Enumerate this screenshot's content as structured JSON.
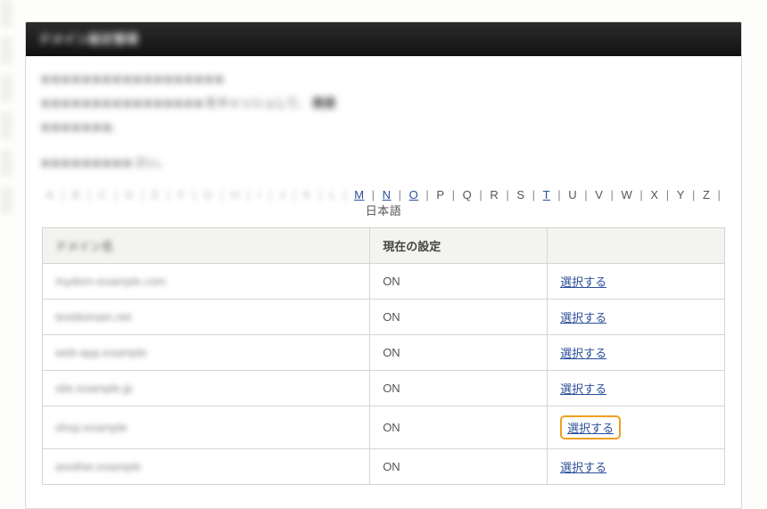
{
  "header": {
    "title_blur": "ドメイン設定管理"
  },
  "description": {
    "line1_blur": "■ ■ ■ ■ ■ ■ ■ ■ ■ ■ ■ ■ ■ ■ ■ ■ ■ ■",
    "line2_blur": "■ ■ ■ ■ ■ ■ ■ ■  ■ ■ ■ ■ ■ ■ ■ ■",
    "line2_sharp_a": "をキャッシュして、",
    "line2_sharp_b": "高速",
    "line3_blur": "■ ■ ■ ■ ■ ■ ■。"
  },
  "instruction": {
    "blur_a": "■ ■ ■ ■  ■ ■ ■ ■ ■",
    "sharp_tail": "さい。"
  },
  "alpha": {
    "dim": [
      "A",
      "B",
      "C",
      "D",
      "E",
      "F",
      "G",
      "H",
      "I",
      "J",
      "K",
      "L"
    ],
    "links": [
      "M",
      "N",
      "O",
      "T"
    ],
    "plain": [
      "P",
      "Q",
      "R",
      "S",
      "U",
      "V",
      "W",
      "X",
      "Y",
      "Z"
    ],
    "last": "日本語",
    "order": [
      "M",
      "N",
      "O",
      "P",
      "Q",
      "R",
      "S",
      "T",
      "U",
      "V",
      "W",
      "X",
      "Y",
      "Z",
      "日本語"
    ]
  },
  "table": {
    "headers": {
      "col1_blur": "ドメイン名",
      "col2": "現在の設定",
      "col3_blur": ""
    },
    "action_label": "選択する",
    "rows": [
      {
        "name_blur": "mydom-example.com",
        "status": "ON",
        "highlight": false
      },
      {
        "name_blur": "testdomain.net",
        "status": "ON",
        "highlight": false
      },
      {
        "name_blur": "web-app.example",
        "status": "ON",
        "highlight": false
      },
      {
        "name_blur": "site.example.jp",
        "status": "ON",
        "highlight": false
      },
      {
        "name_blur": "shop.example",
        "status": "ON",
        "highlight": true
      },
      {
        "name_blur": "another.example",
        "status": "ON",
        "highlight": false
      }
    ]
  }
}
